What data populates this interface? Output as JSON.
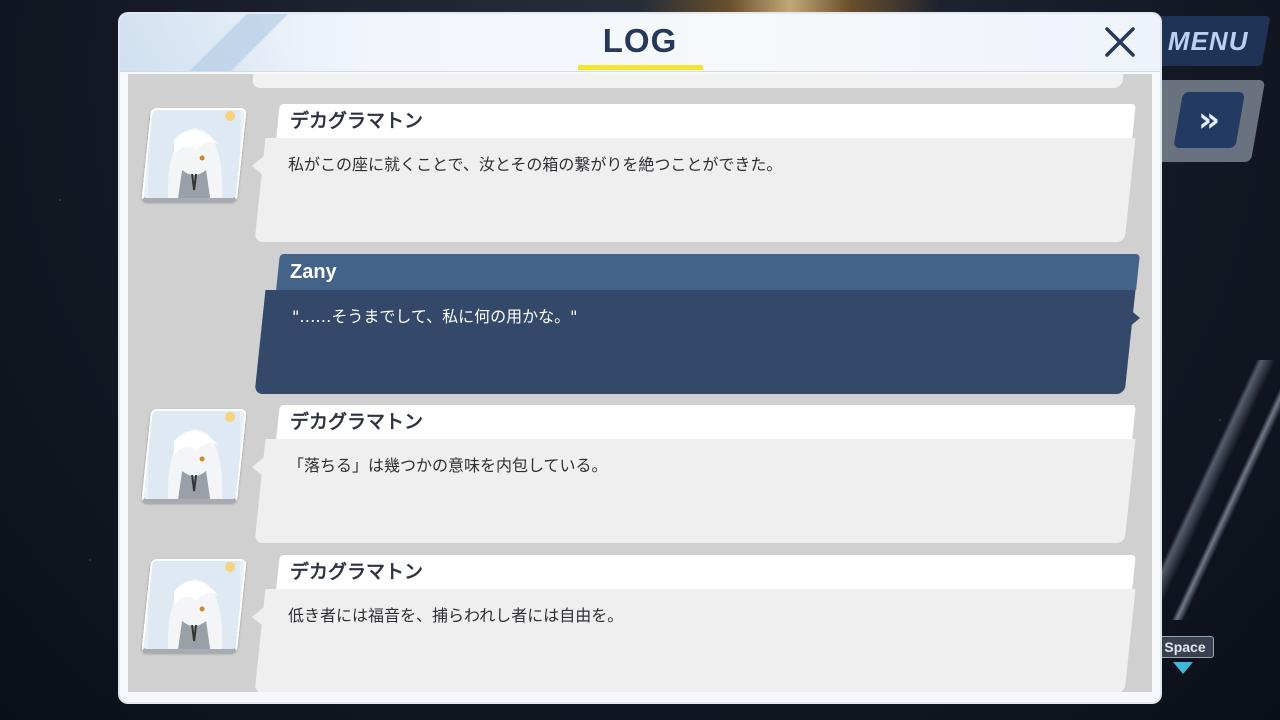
{
  "header": {
    "title": "LOG"
  },
  "background_ui": {
    "menu_label": "MENU",
    "fast_forward_icon": "»",
    "space_key_label": "Space"
  },
  "log_entries": [
    {
      "speaker": "デカグラマトン",
      "text": "私がこの座に就くことで、汝とその箱の繋がりを絶つことができた。",
      "is_player": false
    },
    {
      "speaker": "Zany",
      "text": "\"……そうまでして、私に何の用かな。\"",
      "is_player": true
    },
    {
      "speaker": "デカグラマトン",
      "text": "「落ちる」は幾つかの意味を内包している。",
      "is_player": false
    },
    {
      "speaker": "デカグラマトン",
      "text": "低き者には福音を、捕らわれし者には自由を。",
      "is_player": false
    }
  ],
  "colors": {
    "title": "#27395a",
    "title_underline": "#f3e631",
    "player_name_bar": "#446388",
    "player_text_box": "#34496a",
    "npc_text_box": "#efefef"
  }
}
